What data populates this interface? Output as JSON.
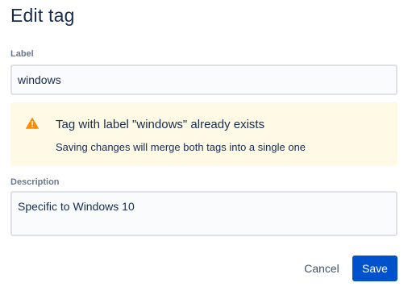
{
  "dialog": {
    "title": "Edit tag"
  },
  "label_field": {
    "label": "Label",
    "value": "windows"
  },
  "warning": {
    "icon": "warning-triangle-icon",
    "color": "#ff8b00",
    "title": "Tag with label \"windows\" already exists",
    "message": "Saving changes will merge both tags into a single one"
  },
  "description_field": {
    "label": "Description",
    "value": "Specific to Windows 10"
  },
  "actions": {
    "cancel_label": "Cancel",
    "save_label": "Save"
  }
}
